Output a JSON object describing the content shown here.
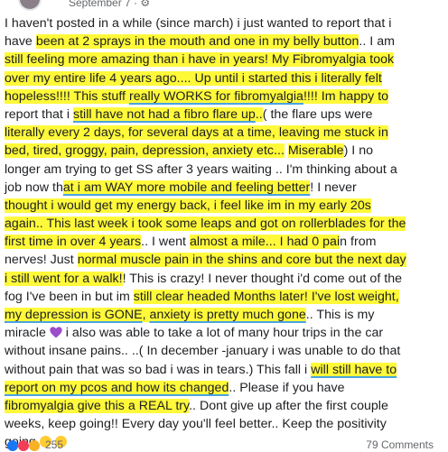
{
  "header": {
    "date": "September 7 · ⚙"
  },
  "post": {
    "lines": [
      [
        "I haven't posted in a while (since march) i just wanted to report that i"
      ],
      [
        "have ",
        "been at 2 sprays in the mouth and one in my belly button",
        ".. I am"
      ],
      [
        "still feeling more amazing than i have in years! My Fibromyalgia took"
      ],
      [
        "over my entire life 4 years ago.... Up until i started this i literally felt"
      ],
      [
        "hopeless!!!! ",
        "This stuff ",
        "really WORKS for fibromyalgia",
        "!!!! Im happy to"
      ],
      [
        "report that i ",
        "still have not had a fibro flare up",
        "..",
        "( the flare ups were"
      ],
      [
        "literally every 2 days, for several days at a time, leaving me stuck in"
      ],
      [
        "bed, tired, groggy, pain, depression, anxiety etc...",
        " ",
        "Miserable",
        ")  I no"
      ],
      [
        "longer am trying to get SS after 3 years waiting .. I'm thinking about a"
      ],
      [
        "job now th",
        "at i am WAY more mobile and feeling better",
        "! I never"
      ],
      [
        "thought i would get my energy back, i feel like im in my early 20s"
      ],
      [
        "again.. This last week i took some leaps and got on rollerblades for the"
      ],
      [
        "first time in over 4 years",
        ".. I went ",
        "almost a mile",
        "... I had 0 pai",
        "n from"
      ],
      [
        "nerves! Just ",
        "normal muscle pain in the shins and core but the next day"
      ],
      [
        "i still went for a walk!",
        "! This is crazy! I never thought i'd come out of the"
      ],
      [
        "fog I've been in but im ",
        "still clear headed Months later! I've lost weight,"
      ],
      [
        "my depression is GONE",
        ", ",
        "anxiety is pretty much gone",
        ".. This is my"
      ],
      [
        "miracle ",
        "  i also was able to take a lot of many hour trips in the car"
      ],
      [
        "without insane pains.. ..( In december -january i was unable to do that"
      ],
      [
        "without pain that was so bad i was in tears.) This fall i ",
        "will still have to"
      ],
      [
        "report on my pcos and how its changed",
        ".. Please if you have"
      ],
      [
        "fibromyalgia give this a REAL try",
        ".. Dont give up after the first couple"
      ],
      [
        "weeks, keep going!! Every day you'll feel better.. Keep the positivity"
      ],
      [
        "going "
      ]
    ]
  },
  "footer": {
    "reactions": "255",
    "comments": "79 Comments"
  }
}
